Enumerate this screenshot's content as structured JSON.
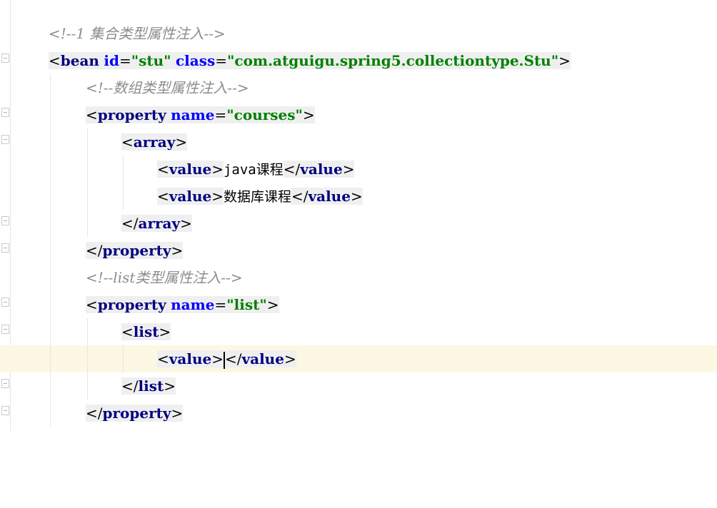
{
  "editor": {
    "lines": [
      {
        "comment": "<!--1 集合类型属性注入-->"
      },
      {
        "open": "<",
        "tag": "bean",
        "sp1": " ",
        "attr1": "id",
        "eq1": "=",
        "val1": "\"stu\"",
        "sp2": " ",
        "attr2": "class",
        "eq2": "=",
        "val2": "\"com.atguigu.spring5.collectiontype.Stu\"",
        "close": ">"
      },
      {
        "comment": "<!--数组类型属性注入-->"
      },
      {
        "open": "<",
        "tag": "property",
        "sp1": " ",
        "attr1": "name",
        "eq1": "=",
        "val1": "\"courses\"",
        "close": ">"
      },
      {
        "open": "<",
        "tag": "array",
        "close": ">"
      },
      {
        "open": "<",
        "tag": "value",
        "close": ">",
        "text": "java课程",
        "endopen": "</",
        "endtag": "value",
        "endclose": ">"
      },
      {
        "open": "<",
        "tag": "value",
        "close": ">",
        "text": "数据库课程",
        "endopen": "</",
        "endtag": "value",
        "endclose": ">"
      },
      {
        "open": "</",
        "tag": "array",
        "close": ">"
      },
      {
        "open": "</",
        "tag": "property",
        "close": ">"
      },
      {
        "comment": "<!--list类型属性注入-->"
      },
      {
        "open": "<",
        "tag": "property",
        "sp1": " ",
        "attr1": "name",
        "eq1": "=",
        "val1": "\"list\"",
        "close": ">"
      },
      {
        "open": "<",
        "tag": "list",
        "close": ">"
      },
      {
        "open": "<",
        "tag": "value",
        "close": ">",
        "endopen": "</",
        "endtag": "value",
        "endclose": ">"
      },
      {
        "open": "</",
        "tag": "list",
        "close": ">"
      },
      {
        "open": "</",
        "tag": "property",
        "close": ">"
      }
    ]
  }
}
